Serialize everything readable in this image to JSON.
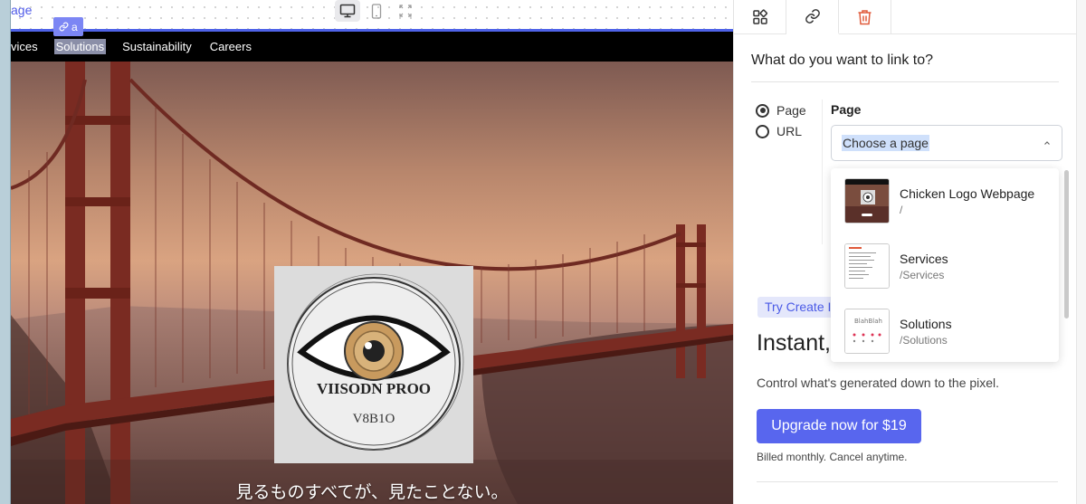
{
  "canvas": {
    "breadcrumb": "age",
    "link_tag_label": "a",
    "nav_items": [
      "vices",
      "Solutions",
      "Sustainability",
      "Careers"
    ],
    "hero_caption": "見るものすべてが、見たことない。",
    "logo_text": "VIISODN PROO",
    "logo_subtext": "V8B1O"
  },
  "device_toolbar": {
    "icons": [
      "desktop-icon",
      "mobile-icon",
      "fullscreen-icon"
    ],
    "active": "desktop"
  },
  "panel": {
    "tabs": [
      {
        "icon": "components-icon"
      },
      {
        "icon": "link-icon",
        "active": true
      },
      {
        "icon": "trash-icon"
      }
    ],
    "title": "What do you want to link to?",
    "link_types": [
      {
        "label": "Page",
        "selected": true
      },
      {
        "label": "URL",
        "selected": false
      }
    ],
    "page_field": {
      "label": "Page",
      "placeholder": "Choose a page",
      "open": true
    },
    "pages": [
      {
        "name": "Chicken Logo Webpage",
        "path": "/"
      },
      {
        "name": "Services",
        "path": "/Services"
      },
      {
        "name": "Solutions",
        "path": "/Solutions"
      }
    ],
    "promo": {
      "badge": "Try Create I",
      "heading": "Instant,",
      "body": "Control what's generated down to the pixel.",
      "button": "Upgrade now for $19",
      "note": "Billed monthly. Cancel anytime."
    }
  },
  "colors": {
    "accent": "#5866ee",
    "selection_blue": "#4f63e8",
    "delete_red": "#e05a3a"
  }
}
